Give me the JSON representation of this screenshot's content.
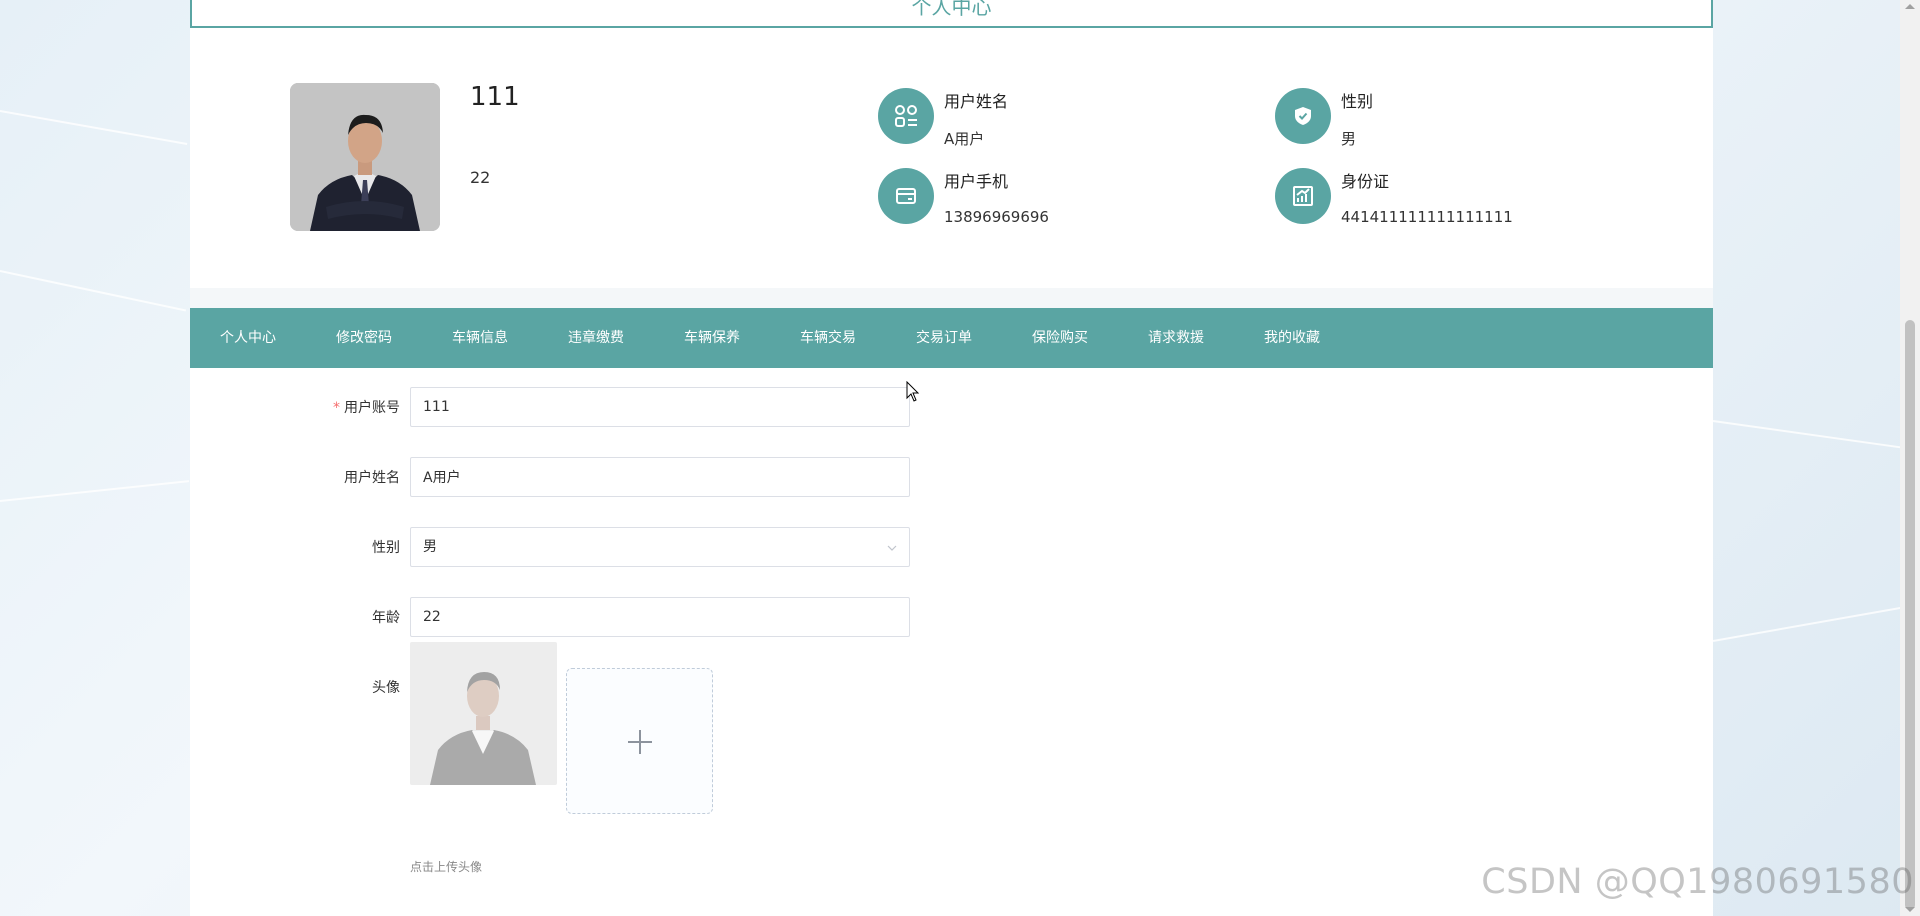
{
  "header": {
    "title": "个人中心"
  },
  "profile": {
    "name": "111",
    "age": "22",
    "info": [
      {
        "label": "用户姓名",
        "value": "A用户",
        "icon": "grid-list-icon"
      },
      {
        "label": "性别",
        "value": "男",
        "icon": "shield-check-icon"
      },
      {
        "label": "用户手机",
        "value": "13896969696",
        "icon": "card-icon"
      },
      {
        "label": "身份证",
        "value": "441411111111111111",
        "icon": "chart-icon"
      }
    ]
  },
  "nav": {
    "items": [
      "个人中心",
      "修改密码",
      "车辆信息",
      "违章缴费",
      "车辆保养",
      "车辆交易",
      "交易订单",
      "保险购买",
      "请求救援",
      "我的收藏"
    ],
    "active_index": 0
  },
  "form": {
    "account": {
      "label": "用户账号",
      "value": "111",
      "required": true
    },
    "name": {
      "label": "用户姓名",
      "value": "A用户"
    },
    "gender": {
      "label": "性别",
      "value": "男"
    },
    "age": {
      "label": "年龄",
      "value": "22"
    },
    "avatar": {
      "label": "头像",
      "tip": "点击上传头像"
    }
  },
  "colors": {
    "accent": "#5aa5a3",
    "required": "#f56c6c"
  },
  "watermark": "CSDN @QQ1980691580"
}
